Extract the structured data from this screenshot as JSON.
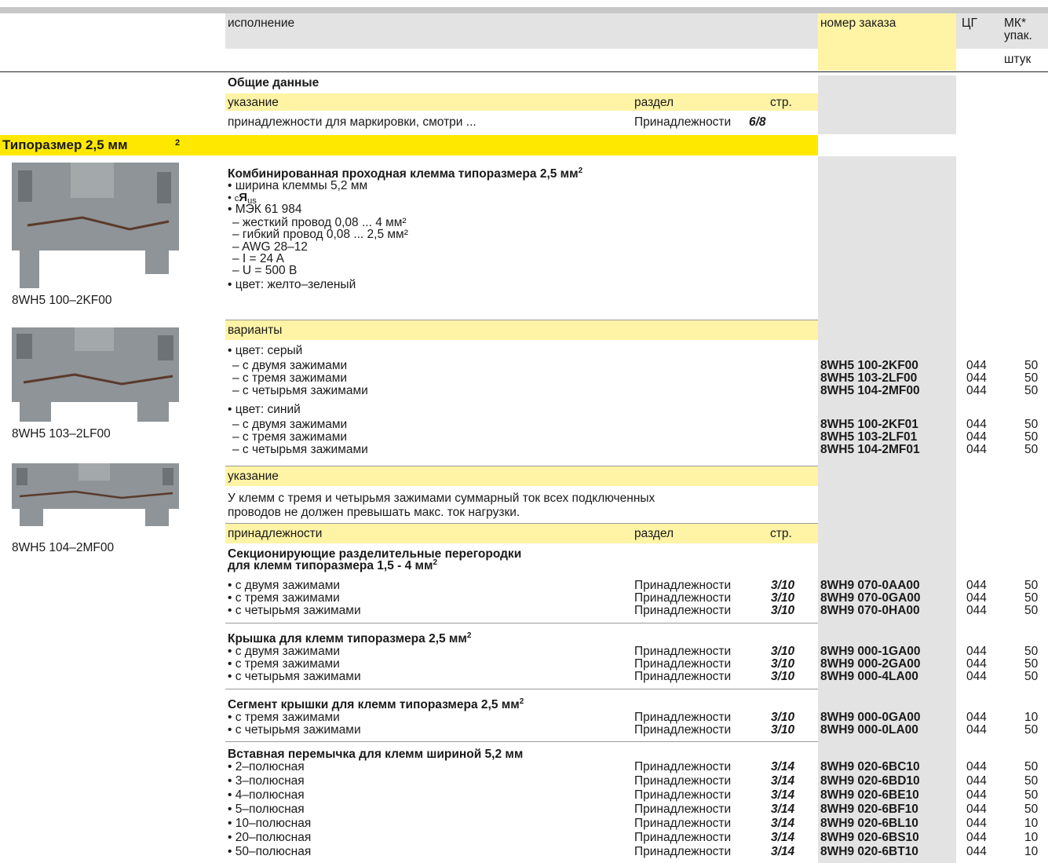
{
  "header": {
    "col_design": "исполнение",
    "col_order": "номер заказа",
    "col_pg": "ЦГ",
    "col_mk": "МК*",
    "col_mk2": "упак.",
    "col_unit": "штук"
  },
  "general": {
    "title": "Общие данные",
    "note_label": "указание",
    "section_label": "раздел",
    "page_label": "стр.",
    "row_text": "принадлежности для маркировки, смотри ...",
    "row_section": "Принадлежности",
    "row_page": "6/8"
  },
  "size_banner": {
    "text": "Типоразмер 2,5 мм",
    "sup": "2"
  },
  "product": {
    "title": "Комбинированная проходная клемма типоразмера 2,5 мм",
    "title_sup": "2",
    "specs": [
      "• ширина клеммы 5,2 мм",
      "• c UL us",
      "• МЭК 61 984",
      "– жесткий провод 0,08 ... 4 мм²",
      "– гибкий провод 0,08 ... 2,5 мм²",
      "– AWG 28–12",
      "– I = 24 A",
      "– U = 500 В",
      "• цвет: желто–зеленый"
    ]
  },
  "images": [
    {
      "caption": "8WH5 100–2KF00"
    },
    {
      "caption": "8WH5 103–2LF00"
    },
    {
      "caption": "8WH5 104–2MF00"
    }
  ],
  "variants": {
    "label": "варианты",
    "color_gray": "• цвет: серый",
    "color_blue": "• цвет: синий",
    "rows_gray": [
      {
        "text": "– с двумя зажимами",
        "order": "8WH5 100-2KF00",
        "pg": "044",
        "qty": "50"
      },
      {
        "text": "– с тремя зажимами",
        "order": "8WH5 103-2LF00",
        "pg": "044",
        "qty": "50"
      },
      {
        "text": "– с четырьмя зажимами",
        "order": "8WH5 104-2MF00",
        "pg": "044",
        "qty": "50"
      }
    ],
    "rows_blue": [
      {
        "text": "– с двумя зажимами",
        "order": "8WH5 100-2KF01",
        "pg": "044",
        "qty": "50"
      },
      {
        "text": "– с тремя зажимами",
        "order": "8WH5 103-2LF01",
        "pg": "044",
        "qty": "50"
      },
      {
        "text": "– с четырьмя зажимами",
        "order": "8WH5 104-2MF01",
        "pg": "044",
        "qty": "50"
      }
    ]
  },
  "note": {
    "label": "указание",
    "line1": "У клемм с тремя и четырьмя зажимами суммарный ток всех подключенных",
    "line2": "проводов не должен превышать макс. ток нагрузки."
  },
  "accessories": {
    "label": "принадлежности",
    "section_label": "раздел",
    "page_label": "стр.",
    "groups": [
      {
        "title1": "Секционирующие разделительные перегородки",
        "title2": "для клемм типоразмера 1,5 - 4 мм",
        "sup": "2",
        "rows": [
          {
            "text": "• с двумя зажимами",
            "section": "Принадлежности",
            "page": "3/10",
            "order": "8WH9 070-0AA00",
            "pg": "044",
            "qty": "50"
          },
          {
            "text": "• с тремя зажимами",
            "section": "Принадлежности",
            "page": "3/10",
            "order": "8WH9 070-0GA00",
            "pg": "044",
            "qty": "50"
          },
          {
            "text": "• с четырьмя зажимами",
            "section": "Принадлежности",
            "page": "3/10",
            "order": "8WH9 070-0HA00",
            "pg": "044",
            "qty": "50"
          }
        ]
      },
      {
        "title1": "Крышка для клемм типоразмера 2,5 мм",
        "sup": "2",
        "rows": [
          {
            "text": "• с двумя зажимами",
            "section": "Принадлежности",
            "page": "3/10",
            "order": "8WH9 000-1GA00",
            "pg": "044",
            "qty": "50"
          },
          {
            "text": "• с тремя зажимами",
            "section": "Принадлежности",
            "page": "3/10",
            "order": "8WH9 000-2GA00",
            "pg": "044",
            "qty": "50"
          },
          {
            "text": "• с четырьмя зажимами",
            "section": "Принадлежности",
            "page": "3/10",
            "order": "8WH9 000-4LA00",
            "pg": "044",
            "qty": "50"
          }
        ]
      },
      {
        "title1": "Сегмент крышки для клемм типоразмера 2,5 мм",
        "sup": "2",
        "rows": [
          {
            "text": "• с тремя зажимами",
            "section": "Принадлежности",
            "page": "3/10",
            "order": "8WH9 000-0GA00",
            "pg": "044",
            "qty": "10"
          },
          {
            "text": "• с четырьмя зажимами",
            "section": "Принадлежности",
            "page": "3/10",
            "order": "8WH9 000-0LA00",
            "pg": "044",
            "qty": "50"
          }
        ]
      },
      {
        "title1": "Вставная перемычка для клемм шириной 5,2 мм",
        "rows": [
          {
            "text": "• 2–полюсная",
            "section": "Принадлежности",
            "page": "3/14",
            "order": "8WH9 020-6BC10",
            "pg": "044",
            "qty": "50"
          },
          {
            "text": "• 3–полюсная",
            "section": "Принадлежности",
            "page": "3/14",
            "order": "8WH9 020-6BD10",
            "pg": "044",
            "qty": "50"
          },
          {
            "text": "• 4–полюсная",
            "section": "Принадлежности",
            "page": "3/14",
            "order": "8WH9 020-6BE10",
            "pg": "044",
            "qty": "50"
          },
          {
            "text": "• 5–полюсная",
            "section": "Принадлежности",
            "page": "3/14",
            "order": "8WH9 020-6BF10",
            "pg": "044",
            "qty": "50"
          },
          {
            "text": "• 10–полюсная",
            "section": "Принадлежности",
            "page": "3/14",
            "order": "8WH9 020-6BL10",
            "pg": "044",
            "qty": "10"
          },
          {
            "text": "• 20–полюсная",
            "section": "Принадлежности",
            "page": "3/14",
            "order": "8WH9 020-6BS10",
            "pg": "044",
            "qty": "10"
          },
          {
            "text": "• 50–полюсная",
            "section": "Принадлежности",
            "page": "3/14",
            "order": "8WH9 020-6BT10",
            "pg": "044",
            "qty": "10"
          }
        ]
      }
    ]
  }
}
